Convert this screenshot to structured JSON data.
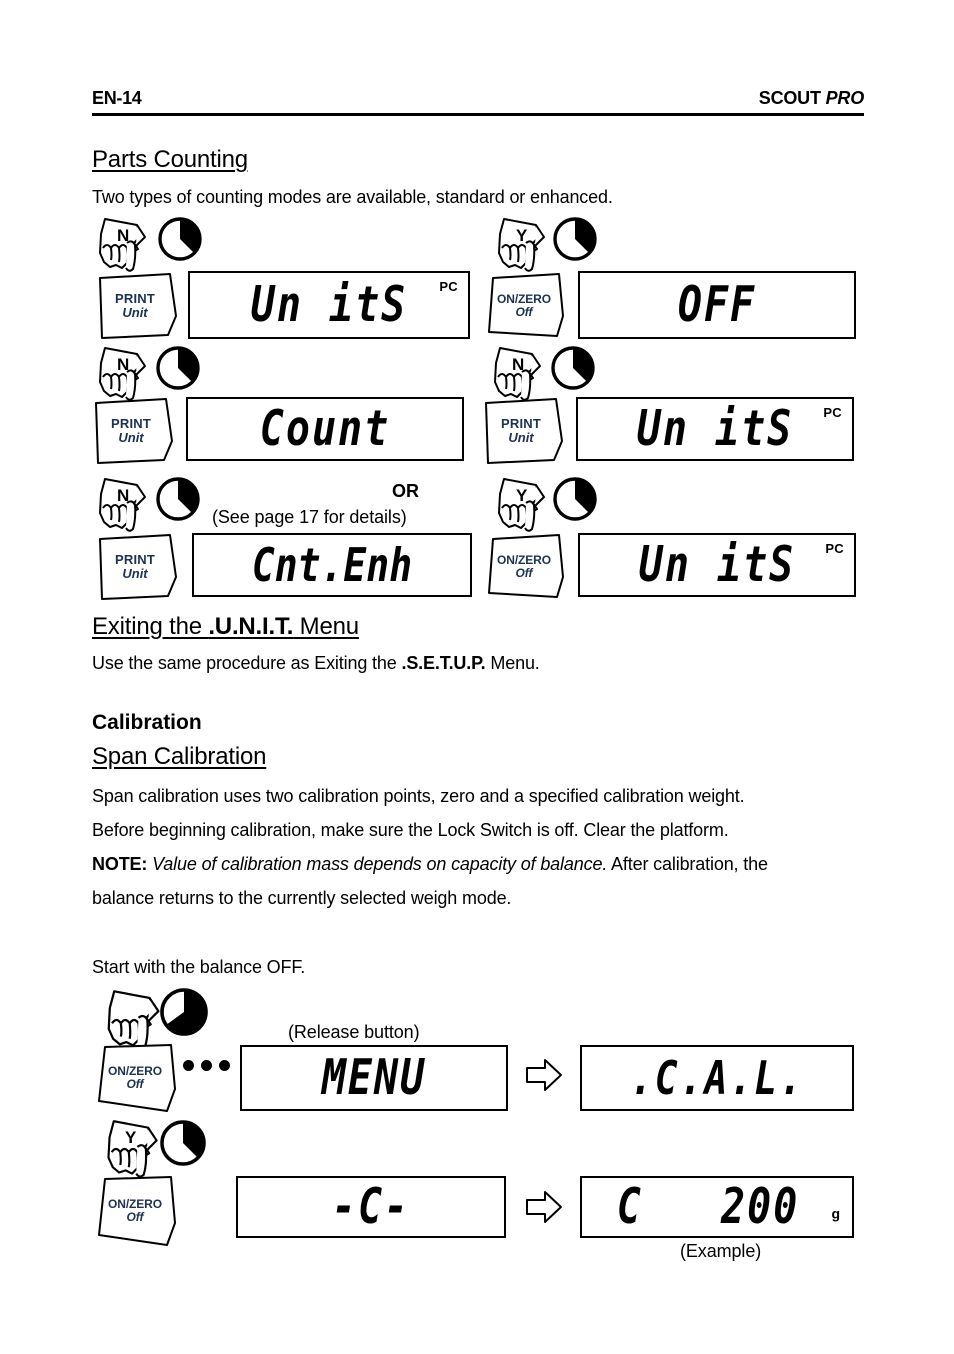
{
  "header": {
    "page_label": "EN-14",
    "product": "SCOUT ",
    "product_italic": "PRO"
  },
  "sections": {
    "parts_counting": {
      "heading": "Parts Counting",
      "intro": "Two types of counting modes are available, standard or enhanced."
    },
    "exiting_unit": {
      "heading_pre": "Exiting the ",
      "heading_bold": ".U.N.I.T.",
      "heading_post": " Menu",
      "body_pre": "Use the same procedure as Exiting the ",
      "body_bold": ".S.E.T.U.P.",
      "body_post": " Menu."
    },
    "calibration": {
      "heading": "Calibration",
      "sub_heading": "Span Calibration",
      "line1": "Span calibration uses two calibration points, zero and a specified calibration weight.",
      "line2": "Before beginning calibration, make sure the Lock Switch is off.  Clear the platform.",
      "note_label": "NOTE:",
      "note_italic": " Value of calibration mass depends on capacity of balance.",
      "note_rest": "  After calibration, the",
      "note_line2": "balance returns to the currently selected weigh mode.",
      "start_text": "Start with the balance OFF."
    }
  },
  "flow_parts_counting": {
    "steps": [
      {
        "hand_label": "N",
        "key_line1": "PRINT",
        "key_line2": "Unit",
        "display": "Un itS",
        "annunciator": "PC",
        "pie_percent": 28
      },
      {
        "hand_label": "Y",
        "key_line1": "ON/ZERO",
        "key_line2": "Off",
        "display": "OFF",
        "annunciator": "",
        "pie_percent": 28
      },
      {
        "hand_label": "N",
        "key_line1": "PRINT",
        "key_line2": "Unit",
        "display": "Count",
        "annunciator": "",
        "pie_percent": 28
      },
      {
        "hand_label": "N",
        "key_line1": "PRINT",
        "key_line2": "Unit",
        "display": "Un itS",
        "annunciator": "PC",
        "pie_percent": 28
      },
      {
        "hand_label": "N",
        "key_line1": "PRINT",
        "key_line2": "Unit",
        "display": "Cnt.Enh",
        "annunciator": "",
        "pie_percent": 28
      },
      {
        "hand_label": "Y",
        "key_line1": "ON/ZERO",
        "key_line2": "Off",
        "display": "Un itS",
        "annunciator": "PC",
        "pie_percent": 28
      }
    ],
    "or_label": "OR",
    "see_page_note": "(See page 17 for details)"
  },
  "flow_calibration": {
    "steps": [
      {
        "hand_label": "",
        "key_line1": "ON/ZERO",
        "key_line2": "Off",
        "display": "MENU",
        "caption": "(Release button)",
        "pie_percent": 72,
        "has_dots": true,
        "result_display": ".C.A.L.",
        "result_unit": "",
        "result_caption": ""
      },
      {
        "hand_label": "Y",
        "key_line1": "ON/ZERO",
        "key_line2": "Off",
        "display": "-C-",
        "caption": "",
        "pie_percent": 28,
        "has_dots": false,
        "result_display": "C   200",
        "result_unit": "g",
        "result_caption": "(Example)"
      }
    ]
  },
  "colors": {
    "key_text": "#1c3252",
    "ink": "#000000",
    "paper": "#ffffff"
  },
  "icons": {
    "hand": "pointing-hand-icon",
    "pie": "press-duration-pie-icon",
    "arrow": "right-arrow-icon",
    "dots": "ellipsis-icon"
  }
}
